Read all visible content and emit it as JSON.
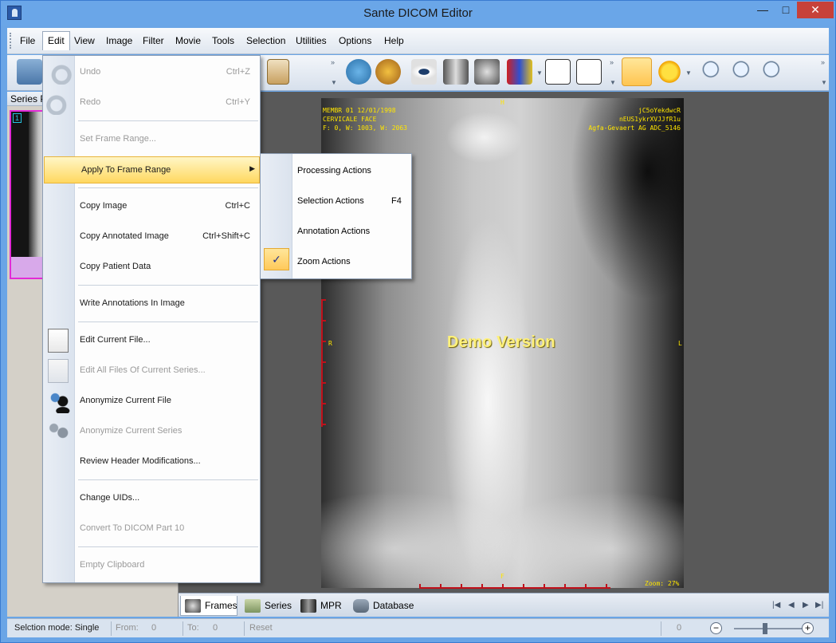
{
  "window": {
    "title": "Sante DICOM Editor"
  },
  "menubar": {
    "items": [
      "File",
      "Edit",
      "View",
      "Image",
      "Filter",
      "Movie",
      "Tools",
      "Selection",
      "Utilities",
      "Options",
      "Help"
    ]
  },
  "series_panel": {
    "header": "Series P",
    "thumb_number": "1"
  },
  "edit_menu": {
    "undo": {
      "label": "Undo",
      "shortcut": "Ctrl+Z"
    },
    "redo": {
      "label": "Redo",
      "shortcut": "Ctrl+Y"
    },
    "set_frame_range": "Set Frame Range...",
    "apply_frame_range": "Apply To Frame Range",
    "copy_image": {
      "label": "Copy Image",
      "shortcut": "Ctrl+C"
    },
    "copy_annotated": {
      "label": "Copy Annotated Image",
      "shortcut": "Ctrl+Shift+C"
    },
    "copy_patient": "Copy Patient Data",
    "write_annotations": "Write Annotations In Image",
    "edit_current": "Edit Current File...",
    "edit_all": "Edit All Files Of Current Series...",
    "anon_file": "Anonymize Current File",
    "anon_series": "Anonymize Current Series",
    "review_header": "Review Header Modifications...",
    "change_uids": "Change UIDs...",
    "convert_dicom": "Convert To DICOM Part 10",
    "empty_clipboard": "Empty Clipboard"
  },
  "submenu": {
    "processing": "Processing Actions",
    "selection": {
      "label": "Selection Actions",
      "shortcut": "F4"
    },
    "annotation": "Annotation Actions",
    "zoom": {
      "label": "Zoom Actions",
      "check": "✓"
    }
  },
  "viewer": {
    "overlay_left": [
      "MEMBR 01 12/01/1998",
      "CERVICALE FACE",
      "F: 0, W: 1003, W: 2063"
    ],
    "overlay_right": [
      "jC5oYekdwcR",
      "nEUS1ykrXVJJfR1u",
      "Agfa-Gevaert AG ADC_5146"
    ],
    "marker_h": "H",
    "marker_r": "R",
    "marker_l": "L",
    "marker_f": "F",
    "zoom": "Zoom: 27%",
    "watermark": "Demo Version"
  },
  "tabs": [
    "Frames",
    "Series",
    "MPR",
    "Database"
  ],
  "status": {
    "mode": "Selction mode: Single",
    "from_label": "From:",
    "from_value": "0",
    "to_label": "To:",
    "to_value": "0",
    "reset": "Reset",
    "zoom_value": "0",
    "minus": "−",
    "plus": "+"
  },
  "window_controls": {
    "minimize": "—",
    "maximize": "□",
    "close": "✕"
  }
}
